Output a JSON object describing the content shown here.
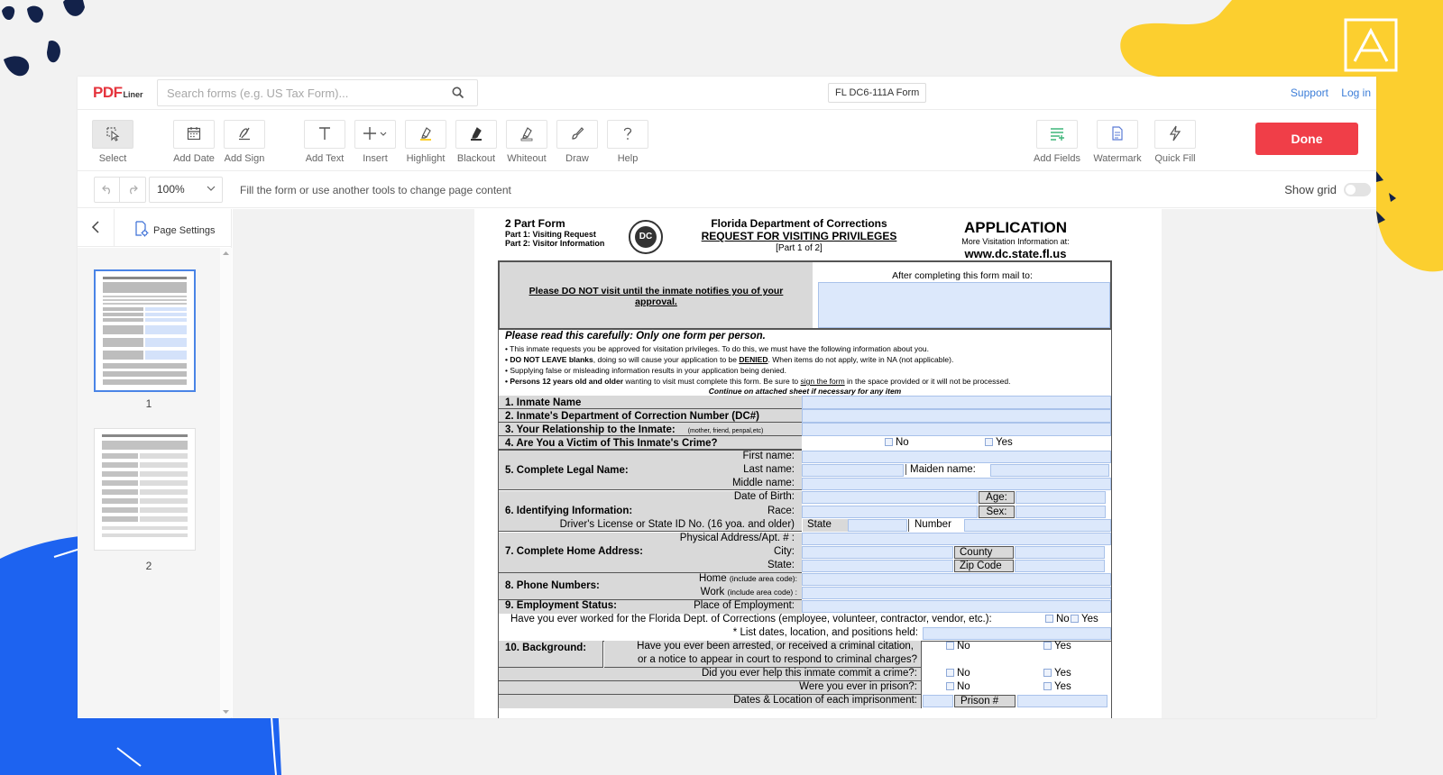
{
  "brand": {
    "name": "PDF",
    "suffix": "Liner"
  },
  "search": {
    "placeholder": "Search forms (e.g. US Tax Form)..."
  },
  "form_name": "FL DC6-111A Form",
  "top_links": {
    "support": "Support",
    "login": "Log in"
  },
  "toolbar": {
    "tools": [
      {
        "label": "Select",
        "icon": "select-icon",
        "active": true
      },
      {
        "label": "Add Date",
        "icon": "calendar-icon"
      },
      {
        "label": "Add Sign",
        "icon": "signature-icon"
      },
      {
        "label": "Add Text",
        "icon": "text-icon"
      },
      {
        "label": "Insert",
        "icon": "plus-icon"
      },
      {
        "label": "Highlight",
        "icon": "highlighter-icon"
      },
      {
        "label": "Blackout",
        "icon": "blackout-icon"
      },
      {
        "label": "Whiteout",
        "icon": "eraser-icon"
      },
      {
        "label": "Draw",
        "icon": "pen-icon"
      },
      {
        "label": "Help",
        "icon": "question-icon"
      }
    ],
    "right_tools": [
      {
        "label": "Add Fields",
        "icon": "fields-icon"
      },
      {
        "label": "Watermark",
        "icon": "watermark-icon"
      },
      {
        "label": "Quick Fill",
        "icon": "bolt-icon"
      }
    ],
    "done_label": "Done"
  },
  "subbar": {
    "zoom": "100%",
    "hint": "Fill the form or use another tools to change page content",
    "show_grid_label": "Show grid",
    "show_grid": false
  },
  "sidebar": {
    "page_settings_label": "Page Settings",
    "pages": [
      {
        "number": "1",
        "selected": true
      },
      {
        "number": "2",
        "selected": false
      }
    ]
  },
  "document": {
    "header": {
      "part_title": "2 Part Form",
      "part1": "Part 1: Visiting Request",
      "part2": "Part 2: Visitor Information",
      "seal_text": "DC",
      "dept": "Florida Department of Corrections",
      "request": "REQUEST FOR VISITING PRIVILEGES",
      "part_of": "[Part 1 of 2]",
      "application": "APPLICATION",
      "more_info": "More Visitation Information at:",
      "website": "www.dc.state.fl.us"
    },
    "notice": {
      "do_not_visit": "Please DO NOT visit until the inmate notifies you of your approval.",
      "mail_to": "After completing this form mail to:"
    },
    "instructions": {
      "title": "Please read this carefully: Only one form per person.",
      "b1": "• This inmate requests you be approved for visitation privileges.  To do this, we must have the following information about you.",
      "b2a": "• DO NOT LEAVE blanks",
      "b2b": ", doing so will cause your application to be ",
      "b2c": "DENIED",
      "b2d": ".  When items do not apply, write in NA (not applicable).",
      "b3": "• Supplying false or misleading information results in your application being denied.",
      "b4a": "• Persons 12 years old and older",
      "b4b": " wanting to visit must complete this form.  Be sure to ",
      "b4c": "sign the form",
      "b4d": " in the space provided or it will not be processed.",
      "continue": "Continue on attached sheet if necessary for any item"
    },
    "q1": "1. Inmate Name",
    "q2": "2. Inmate's Department of Correction Number (DC#)",
    "q3": "3. Your Relationship to the Inmate:",
    "q3_hint": "(mother, friend, penpal,etc)",
    "q4": "4. Are You a Victim of This Inmate's Crime?",
    "no": "No",
    "yes": "Yes",
    "q5": "5. Complete Legal Name:",
    "first_name": "First name:",
    "last_name": "Last name:",
    "middle_name": "Middle name:",
    "maiden_name": "Maiden name:",
    "q6": "6. Identifying Information:",
    "dob": "Date of Birth:",
    "age": "Age:",
    "race": "Race:",
    "sex": "Sex:",
    "dl": "Driver's License or State ID No. (16 yoa. and older)",
    "state": "State",
    "number": "Number",
    "q7": "7. Complete Home Address:",
    "physical": "Physical Address/Apt. # :",
    "city": "City:",
    "county": "County",
    "state2": "State:",
    "zip": "Zip Code",
    "q8": "8. Phone Numbers:",
    "home": "Home",
    "work": "Work",
    "area_code_home": "(include area code):",
    "area_code_work": "(include area code) :",
    "q9": "9. Employment Status:",
    "place": "Place of Employment:",
    "worked": "Have you ever worked for the Florida Dept. of Corrections (employee, volunteer, contractor, vendor, etc.):",
    "list_dates": "* List dates, location, and positions held:",
    "q10": "10. Background:",
    "arrested1": "Have you ever been arrested, or received a criminal citation,",
    "arrested2": "or a notice to appear in court to respond to criminal charges?",
    "help_crime": "Did you ever help this inmate commit a crime?:",
    "prison": "Were you ever in prison?:",
    "dates_loc": "Dates & Location of each imprisonment:",
    "prison_no": "Prison #"
  },
  "colors": {
    "accent": "#f03e48",
    "link": "#3b7dd8",
    "field": "#dce8fb",
    "deco_yellow": "#fccf2f",
    "deco_blue": "#1d63f0",
    "deco_navy": "#13224a"
  }
}
